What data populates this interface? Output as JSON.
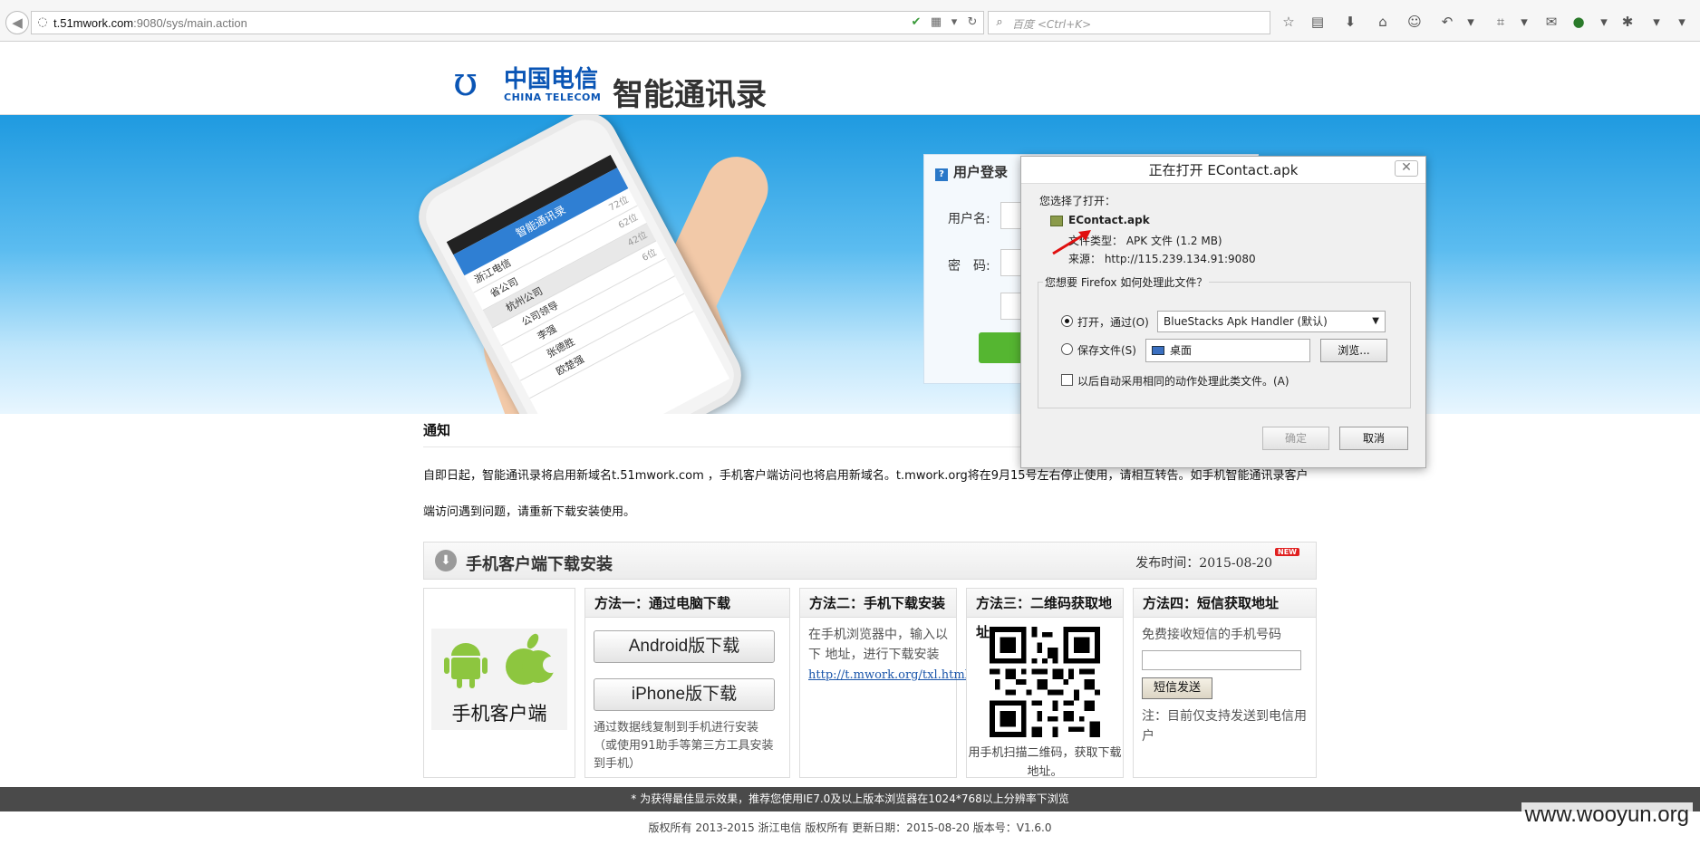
{
  "browser": {
    "back_icon": "back-arrow-icon",
    "url_host": "t.51mwork.com",
    "url_path": ":9080/sys/main.action",
    "search_placeholder": "百度 <Ctrl+K>",
    "toolbar_icons": [
      "bookmark-star-icon",
      "reading-list-icon",
      "download-icon",
      "home-icon",
      "chat-icon",
      "undo-icon",
      "crop-icon",
      "speech-icon",
      "shield-icon",
      "settings-icon",
      "menu-icon"
    ]
  },
  "header": {
    "brand_cn": "中国电信",
    "brand_en": "CHINA TELECOM",
    "app_name": "智能通讯录"
  },
  "phone": {
    "app_title": "智能通讯录",
    "rows": [
      {
        "label": "浙江电信",
        "count": "72位"
      },
      {
        "label": "省公司",
        "count": "62位"
      },
      {
        "label": "杭州公司",
        "count": "42位"
      },
      {
        "label": "公司领导",
        "count": "6位"
      },
      {
        "label": "李强",
        "count": ""
      },
      {
        "label": "张德胜",
        "count": ""
      },
      {
        "label": "欧楚强",
        "count": ""
      }
    ]
  },
  "login": {
    "title": "用户登录",
    "username_label": "用户名:",
    "password_label": "密　码:"
  },
  "notice": {
    "title": "通知",
    "text": "自即日起，智能通讯录将启用新域名t.51mwork.com ，手机客户端访问也将启用新域名。t.mwork.org将在9月15号左右停止使用，请相互转告。如手机智能通讯录客户端访问遇到问题，请重新下载安装使用。"
  },
  "download": {
    "title": "手机客户端下载安装",
    "publish_date": "发布时间：2015-08-20",
    "new_badge": "NEW",
    "client_label": "手机客户端",
    "method1": {
      "title": "方法一：通过电脑下载",
      "android_btn": "Android版下载",
      "iphone_btn": "iPhone版下载",
      "note": "通过数据线复制到手机进行安装（或使用91助手等第三方工具安装到手机）"
    },
    "method2": {
      "title": "方法二：手机下载安装",
      "text": "在手机浏览器中，输入以下 地址，进行下载安装",
      "link": "http://t.mwork.org/txl.html"
    },
    "method3": {
      "title": "方法三：二维码获取地址",
      "caption": "用手机扫描二维码，获取下载地址。"
    },
    "method4": {
      "title": "方法四：短信获取地址",
      "label": "免费接收短信的手机号码",
      "button": "短信发送",
      "note": "注：目前仅支持发送到电信用户"
    }
  },
  "footer": {
    "tip": "* 为获得最佳显示效果，推荐您使用IE7.0及以上版本浏览器在1024*768以上分辨率下浏览",
    "copyright": "版权所有 2013-2015 浙江电信 版权所有 更新日期：2015-08-20 版本号：V1.6.0"
  },
  "watermark": "www.wooyun.org",
  "dialog": {
    "title": "正在打开 EContact.apk",
    "close_glyph": "✕",
    "chosen_label": "您选择了打开：",
    "file_name": "EContact.apk",
    "file_type": "文件类型： APK 文件 (1.2 MB)",
    "source": "来源： http://115.239.134.91:9080",
    "question": "您想要 Firefox 如何处理此文件？",
    "open_with_label": "打开，通过(O)",
    "open_with_value": "BlueStacks Apk Handler (默认)",
    "save_label": "保存文件(S)",
    "save_location": "桌面",
    "browse_btn": "浏览...",
    "auto_label": "以后自动采用相同的动作处理此类文件。(A)",
    "ok_btn": "确定",
    "cancel_btn": "取消"
  }
}
